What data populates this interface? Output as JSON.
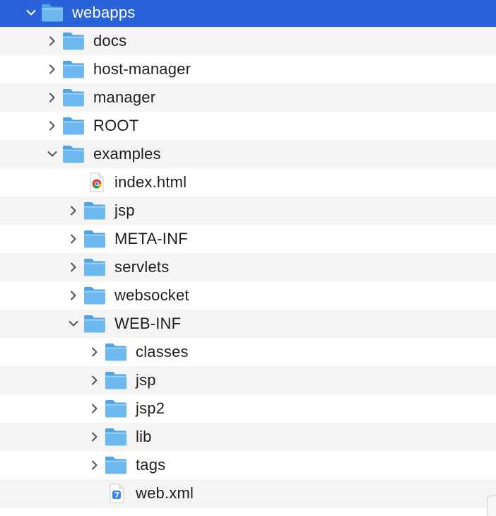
{
  "tree": [
    {
      "label": "webapps",
      "depth": 0,
      "kind": "folder",
      "expanded": true,
      "selected": true
    },
    {
      "label": "docs",
      "depth": 1,
      "kind": "folder",
      "expanded": false
    },
    {
      "label": "host-manager",
      "depth": 1,
      "kind": "folder",
      "expanded": false
    },
    {
      "label": "manager",
      "depth": 1,
      "kind": "folder",
      "expanded": false
    },
    {
      "label": "ROOT",
      "depth": 1,
      "kind": "folder",
      "expanded": false
    },
    {
      "label": "examples",
      "depth": 1,
      "kind": "folder",
      "expanded": true
    },
    {
      "label": "index.html",
      "depth": 2,
      "kind": "html-file"
    },
    {
      "label": "jsp",
      "depth": 2,
      "kind": "folder",
      "expanded": false
    },
    {
      "label": "META-INF",
      "depth": 2,
      "kind": "folder",
      "expanded": false
    },
    {
      "label": "servlets",
      "depth": 2,
      "kind": "folder",
      "expanded": false
    },
    {
      "label": "websocket",
      "depth": 2,
      "kind": "folder",
      "expanded": false
    },
    {
      "label": "WEB-INF",
      "depth": 2,
      "kind": "folder",
      "expanded": true
    },
    {
      "label": "classes",
      "depth": 3,
      "kind": "folder",
      "expanded": false
    },
    {
      "label": "jsp",
      "depth": 3,
      "kind": "folder",
      "expanded": false
    },
    {
      "label": "jsp2",
      "depth": 3,
      "kind": "folder",
      "expanded": false
    },
    {
      "label": "lib",
      "depth": 3,
      "kind": "folder",
      "expanded": false
    },
    {
      "label": "tags",
      "depth": 3,
      "kind": "folder",
      "expanded": false
    },
    {
      "label": "web.xml",
      "depth": 3,
      "kind": "xml-file"
    }
  ],
  "colors": {
    "selection": "#2a62d9",
    "folder_body": "#6db8ef",
    "folder_tab": "#4ea3e2",
    "stripe": "#f4f4f4"
  }
}
